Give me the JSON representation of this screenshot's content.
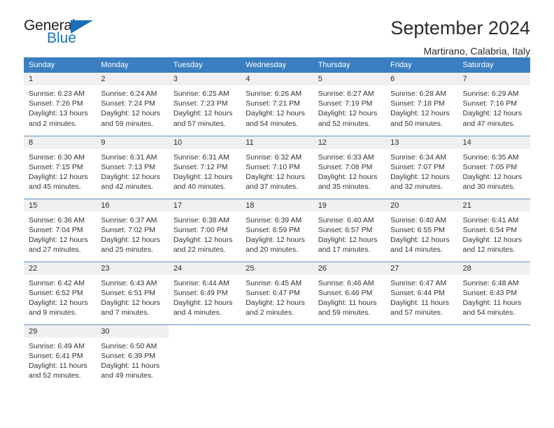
{
  "logo": {
    "text_primary": "General",
    "text_secondary": "Blue",
    "triangle_color": "#1a70b8",
    "primary_color": "#231f20",
    "secondary_color": "#1673c0"
  },
  "header": {
    "title": "September 2024",
    "subtitle": "Martirano, Calabria, Italy"
  },
  "theme": {
    "header_row_bg": "#3a7fc1",
    "header_row_text": "#ffffff",
    "daynum_band_bg": "#f0f0f0",
    "grid_line": "#4a86c4",
    "cell_bg": "#ffffff",
    "body_text": "#333333"
  },
  "weekday_headers": [
    "Sunday",
    "Monday",
    "Tuesday",
    "Wednesday",
    "Thursday",
    "Friday",
    "Saturday"
  ],
  "labels": {
    "sunrise_prefix": "Sunrise:",
    "sunset_prefix": "Sunset:",
    "daylight_prefix": "Daylight:"
  },
  "weeks": [
    [
      {
        "day": "1",
        "sunrise": "Sunrise: 6:23 AM",
        "sunset": "Sunset: 7:26 PM",
        "daylight_1": "Daylight: 13 hours",
        "daylight_2": "and 2 minutes."
      },
      {
        "day": "2",
        "sunrise": "Sunrise: 6:24 AM",
        "sunset": "Sunset: 7:24 PM",
        "daylight_1": "Daylight: 12 hours",
        "daylight_2": "and 59 minutes."
      },
      {
        "day": "3",
        "sunrise": "Sunrise: 6:25 AM",
        "sunset": "Sunset: 7:23 PM",
        "daylight_1": "Daylight: 12 hours",
        "daylight_2": "and 57 minutes."
      },
      {
        "day": "4",
        "sunrise": "Sunrise: 6:26 AM",
        "sunset": "Sunset: 7:21 PM",
        "daylight_1": "Daylight: 12 hours",
        "daylight_2": "and 54 minutes."
      },
      {
        "day": "5",
        "sunrise": "Sunrise: 6:27 AM",
        "sunset": "Sunset: 7:19 PM",
        "daylight_1": "Daylight: 12 hours",
        "daylight_2": "and 52 minutes."
      },
      {
        "day": "6",
        "sunrise": "Sunrise: 6:28 AM",
        "sunset": "Sunset: 7:18 PM",
        "daylight_1": "Daylight: 12 hours",
        "daylight_2": "and 50 minutes."
      },
      {
        "day": "7",
        "sunrise": "Sunrise: 6:29 AM",
        "sunset": "Sunset: 7:16 PM",
        "daylight_1": "Daylight: 12 hours",
        "daylight_2": "and 47 minutes."
      }
    ],
    [
      {
        "day": "8",
        "sunrise": "Sunrise: 6:30 AM",
        "sunset": "Sunset: 7:15 PM",
        "daylight_1": "Daylight: 12 hours",
        "daylight_2": "and 45 minutes."
      },
      {
        "day": "9",
        "sunrise": "Sunrise: 6:31 AM",
        "sunset": "Sunset: 7:13 PM",
        "daylight_1": "Daylight: 12 hours",
        "daylight_2": "and 42 minutes."
      },
      {
        "day": "10",
        "sunrise": "Sunrise: 6:31 AM",
        "sunset": "Sunset: 7:12 PM",
        "daylight_1": "Daylight: 12 hours",
        "daylight_2": "and 40 minutes."
      },
      {
        "day": "11",
        "sunrise": "Sunrise: 6:32 AM",
        "sunset": "Sunset: 7:10 PM",
        "daylight_1": "Daylight: 12 hours",
        "daylight_2": "and 37 minutes."
      },
      {
        "day": "12",
        "sunrise": "Sunrise: 6:33 AM",
        "sunset": "Sunset: 7:08 PM",
        "daylight_1": "Daylight: 12 hours",
        "daylight_2": "and 35 minutes."
      },
      {
        "day": "13",
        "sunrise": "Sunrise: 6:34 AM",
        "sunset": "Sunset: 7:07 PM",
        "daylight_1": "Daylight: 12 hours",
        "daylight_2": "and 32 minutes."
      },
      {
        "day": "14",
        "sunrise": "Sunrise: 6:35 AM",
        "sunset": "Sunset: 7:05 PM",
        "daylight_1": "Daylight: 12 hours",
        "daylight_2": "and 30 minutes."
      }
    ],
    [
      {
        "day": "15",
        "sunrise": "Sunrise: 6:36 AM",
        "sunset": "Sunset: 7:04 PM",
        "daylight_1": "Daylight: 12 hours",
        "daylight_2": "and 27 minutes."
      },
      {
        "day": "16",
        "sunrise": "Sunrise: 6:37 AM",
        "sunset": "Sunset: 7:02 PM",
        "daylight_1": "Daylight: 12 hours",
        "daylight_2": "and 25 minutes."
      },
      {
        "day": "17",
        "sunrise": "Sunrise: 6:38 AM",
        "sunset": "Sunset: 7:00 PM",
        "daylight_1": "Daylight: 12 hours",
        "daylight_2": "and 22 minutes."
      },
      {
        "day": "18",
        "sunrise": "Sunrise: 6:39 AM",
        "sunset": "Sunset: 6:59 PM",
        "daylight_1": "Daylight: 12 hours",
        "daylight_2": "and 20 minutes."
      },
      {
        "day": "19",
        "sunrise": "Sunrise: 6:40 AM",
        "sunset": "Sunset: 6:57 PM",
        "daylight_1": "Daylight: 12 hours",
        "daylight_2": "and 17 minutes."
      },
      {
        "day": "20",
        "sunrise": "Sunrise: 6:40 AM",
        "sunset": "Sunset: 6:55 PM",
        "daylight_1": "Daylight: 12 hours",
        "daylight_2": "and 14 minutes."
      },
      {
        "day": "21",
        "sunrise": "Sunrise: 6:41 AM",
        "sunset": "Sunset: 6:54 PM",
        "daylight_1": "Daylight: 12 hours",
        "daylight_2": "and 12 minutes."
      }
    ],
    [
      {
        "day": "22",
        "sunrise": "Sunrise: 6:42 AM",
        "sunset": "Sunset: 6:52 PM",
        "daylight_1": "Daylight: 12 hours",
        "daylight_2": "and 9 minutes."
      },
      {
        "day": "23",
        "sunrise": "Sunrise: 6:43 AM",
        "sunset": "Sunset: 6:51 PM",
        "daylight_1": "Daylight: 12 hours",
        "daylight_2": "and 7 minutes."
      },
      {
        "day": "24",
        "sunrise": "Sunrise: 6:44 AM",
        "sunset": "Sunset: 6:49 PM",
        "daylight_1": "Daylight: 12 hours",
        "daylight_2": "and 4 minutes."
      },
      {
        "day": "25",
        "sunrise": "Sunrise: 6:45 AM",
        "sunset": "Sunset: 6:47 PM",
        "daylight_1": "Daylight: 12 hours",
        "daylight_2": "and 2 minutes."
      },
      {
        "day": "26",
        "sunrise": "Sunrise: 6:46 AM",
        "sunset": "Sunset: 6:46 PM",
        "daylight_1": "Daylight: 11 hours",
        "daylight_2": "and 59 minutes."
      },
      {
        "day": "27",
        "sunrise": "Sunrise: 6:47 AM",
        "sunset": "Sunset: 6:44 PM",
        "daylight_1": "Daylight: 11 hours",
        "daylight_2": "and 57 minutes."
      },
      {
        "day": "28",
        "sunrise": "Sunrise: 6:48 AM",
        "sunset": "Sunset: 6:43 PM",
        "daylight_1": "Daylight: 11 hours",
        "daylight_2": "and 54 minutes."
      }
    ],
    [
      {
        "day": "29",
        "sunrise": "Sunrise: 6:49 AM",
        "sunset": "Sunset: 6:41 PM",
        "daylight_1": "Daylight: 11 hours",
        "daylight_2": "and 52 minutes."
      },
      {
        "day": "30",
        "sunrise": "Sunrise: 6:50 AM",
        "sunset": "Sunset: 6:39 PM",
        "daylight_1": "Daylight: 11 hours",
        "daylight_2": "and 49 minutes."
      },
      {
        "day": "",
        "sunrise": "",
        "sunset": "",
        "daylight_1": "",
        "daylight_2": ""
      },
      {
        "day": "",
        "sunrise": "",
        "sunset": "",
        "daylight_1": "",
        "daylight_2": ""
      },
      {
        "day": "",
        "sunrise": "",
        "sunset": "",
        "daylight_1": "",
        "daylight_2": ""
      },
      {
        "day": "",
        "sunrise": "",
        "sunset": "",
        "daylight_1": "",
        "daylight_2": ""
      },
      {
        "day": "",
        "sunrise": "",
        "sunset": "",
        "daylight_1": "",
        "daylight_2": ""
      }
    ]
  ]
}
